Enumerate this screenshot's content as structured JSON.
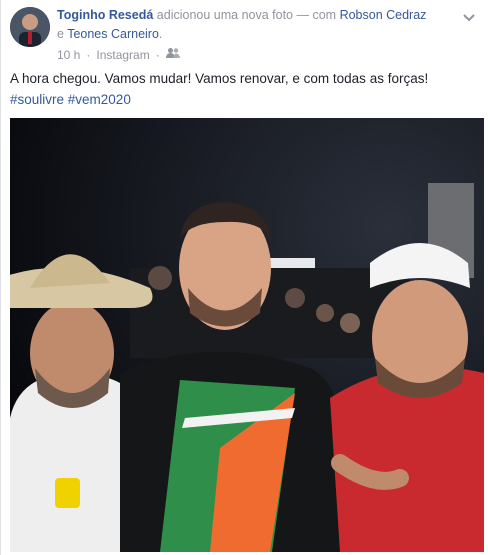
{
  "post": {
    "author": "Toginho Resedá",
    "action_text": "adicionou uma nova foto — com",
    "tagged_1": "Robson Cedraz",
    "conjunction": "e",
    "tagged_2": "Teones Carneiro",
    "period": ".",
    "time": "10 h",
    "separator": "·",
    "source": "Instagram",
    "separator2": "·",
    "audience_icon": "friends-icon",
    "text": "A hora chegou. Vamos mudar! Vamos renovar, e com todas as forças!",
    "hashtags": "#soulivre #vem2020"
  },
  "colors": {
    "link": "#365899",
    "muted": "#90949c",
    "text": "#1d2129"
  }
}
